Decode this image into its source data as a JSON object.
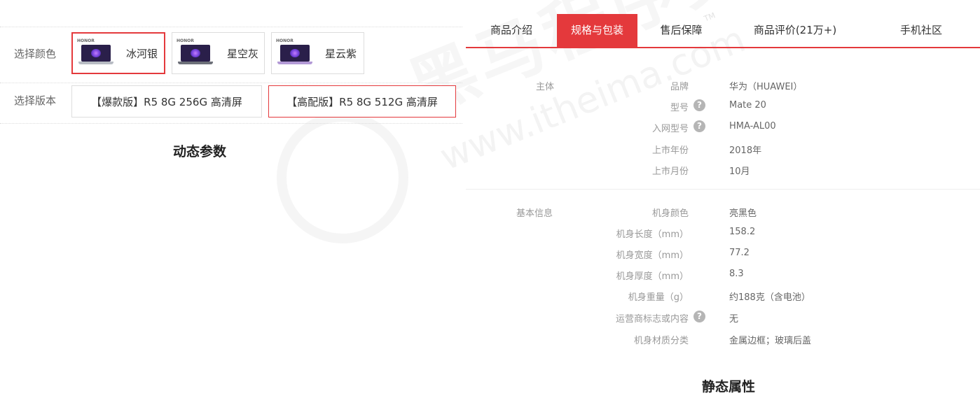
{
  "left": {
    "color_label": "选择颜色",
    "version_label": "选择版本",
    "colors": [
      {
        "brand": "HONOR",
        "name": "冰河银",
        "selected": true
      },
      {
        "brand": "HONOR",
        "name": "星空灰",
        "selected": false
      },
      {
        "brand": "HONOR",
        "name": "星云紫",
        "selected": false
      }
    ],
    "versions": [
      {
        "label": "【爆款版】R5 8G 256G 高清屏",
        "selected": false
      },
      {
        "label": "【高配版】R5 8G 512G 高清屏",
        "selected": true
      }
    ],
    "caption": "动态参数"
  },
  "tabs": [
    {
      "label": "商品介绍",
      "active": false
    },
    {
      "label": "规格与包装",
      "active": true
    },
    {
      "label": "售后保障",
      "active": false
    },
    {
      "label": "商品评价(21万+)",
      "active": false
    },
    {
      "label": "手机社区",
      "active": false
    }
  ],
  "specs": {
    "group1": {
      "title": "主体",
      "rows": [
        {
          "key": "品牌",
          "value": "华为（HUAWEI）",
          "help": false
        },
        {
          "key": "型号",
          "value": "Mate 20",
          "help": true
        },
        {
          "key": "入网型号",
          "value": "HMA-AL00",
          "help": true
        },
        {
          "key": "上市年份",
          "value": "2018年",
          "help": false
        },
        {
          "key": "上市月份",
          "value": "10月",
          "help": false
        }
      ]
    },
    "group2": {
      "title": "基本信息",
      "rows": [
        {
          "key": "机身颜色",
          "value": "亮黑色",
          "help": false
        },
        {
          "key": "机身长度（mm）",
          "value": "158.2",
          "help": false
        },
        {
          "key": "机身宽度（mm）",
          "value": "77.2",
          "help": false
        },
        {
          "key": "机身厚度（mm）",
          "value": "8.3",
          "help": false
        },
        {
          "key": "机身重量（g）",
          "value": "约188克（含电池）",
          "help": false
        },
        {
          "key": "运营商标志或内容",
          "value": "无",
          "help": true
        },
        {
          "key": "机身材质分类",
          "value": "金属边框；玻璃后盖",
          "help": false
        }
      ]
    },
    "help_glyph": "?"
  },
  "caption_right": "静态属性",
  "watermark": {
    "logo_text": "黑马程序员",
    "url_text": "www.itheima.com",
    "tm": "TM"
  },
  "colors": {
    "accent": "#e4393c",
    "border": "#dddddd",
    "muted": "#999999"
  }
}
